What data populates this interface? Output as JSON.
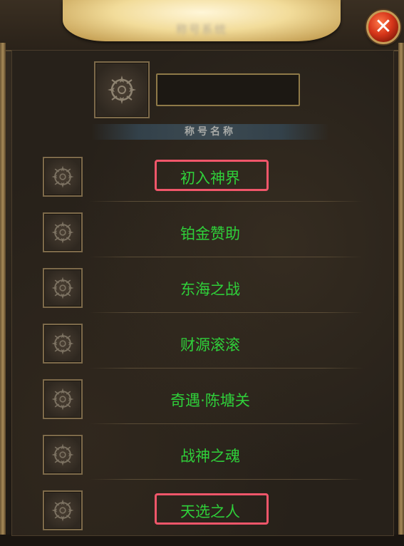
{
  "window": {
    "title": "称号系统",
    "close_icon": "close-x-icon"
  },
  "selected": {
    "icon": "compass-star-icon",
    "name_value": ""
  },
  "list_header": "称号名称",
  "titles": [
    {
      "label": "初入神界",
      "icon": "compass-star-icon",
      "highlighted": true
    },
    {
      "label": "铂金赞助",
      "icon": "compass-star-icon",
      "highlighted": false
    },
    {
      "label": "东海之战",
      "icon": "compass-star-icon",
      "highlighted": false
    },
    {
      "label": "财源滚滚",
      "icon": "compass-star-icon",
      "highlighted": false
    },
    {
      "label": "奇遇·陈塘关",
      "icon": "compass-star-icon",
      "highlighted": false
    },
    {
      "label": "战神之魂",
      "icon": "compass-star-icon",
      "highlighted": false
    },
    {
      "label": "天选之人",
      "icon": "compass-star-icon",
      "highlighted": true
    }
  ],
  "colors": {
    "title_green": "#2fd03a",
    "highlight_red": "#f0566a",
    "gold_border": "#8f7a48"
  }
}
